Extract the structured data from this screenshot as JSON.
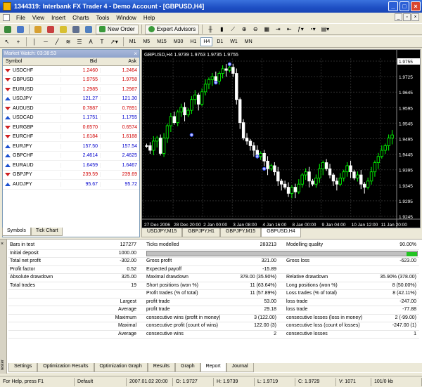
{
  "window": {
    "title": "1344319: Interbank FX Trader 4 - Demo Account - [GBPUSD,H4]"
  },
  "menu": [
    "File",
    "View",
    "Insert",
    "Charts",
    "Tools",
    "Window",
    "Help"
  ],
  "toolbar": {
    "new_order": "New Order",
    "expert_advisors": "Expert Advisors",
    "timeframes": [
      "M1",
      "M5",
      "M15",
      "M30",
      "H1",
      "H4",
      "D1",
      "W1",
      "MN"
    ],
    "active_timeframe": "H4",
    "text_tool": "A",
    "text_label_tool": "T"
  },
  "market_watch": {
    "title": "Market Watch: 03:38:53",
    "columns": [
      "Symbol",
      "Bid",
      "Ask"
    ],
    "rows": [
      {
        "symbol": "USDCHF",
        "bid": "1.2460",
        "ask": "1.2464",
        "dir": "down"
      },
      {
        "symbol": "GBPUSD",
        "bid": "1.9755",
        "ask": "1.9758",
        "dir": "down"
      },
      {
        "symbol": "EURUSD",
        "bid": "1.2985",
        "ask": "1.2987",
        "dir": "down"
      },
      {
        "symbol": "USDJPY",
        "bid": "121.27",
        "ask": "121.30",
        "dir": "up"
      },
      {
        "symbol": "AUDUSD",
        "bid": "0.7887",
        "ask": "0.7891",
        "dir": "down"
      },
      {
        "symbol": "USDCAD",
        "bid": "1.1751",
        "ask": "1.1755",
        "dir": "up"
      },
      {
        "symbol": "EURGBP",
        "bid": "0.6570",
        "ask": "0.6574",
        "dir": "down"
      },
      {
        "symbol": "EURCHF",
        "bid": "1.6184",
        "ask": "1.6188",
        "dir": "down"
      },
      {
        "symbol": "EURJPY",
        "bid": "157.50",
        "ask": "157.54",
        "dir": "up"
      },
      {
        "symbol": "GBPCHF",
        "bid": "2.4614",
        "ask": "2.4625",
        "dir": "up"
      },
      {
        "symbol": "EURAUD",
        "bid": "1.6459",
        "ask": "1.6467",
        "dir": "up"
      },
      {
        "symbol": "GBPJPY",
        "bid": "239.59",
        "ask": "239.69",
        "dir": "down"
      },
      {
        "symbol": "AUDJPY",
        "bid": "95.67",
        "ask": "95.72",
        "dir": "up"
      }
    ],
    "tabs": [
      "Symbols",
      "Tick Chart"
    ]
  },
  "chart": {
    "header": "GBPUSD,H4  1.9739 1.9763 1.9735 1.9755",
    "price_labels": [
      "1.9755",
      "1.9725",
      "1.9645",
      "1.9595",
      "1.9545",
      "1.9495",
      "1.9445",
      "1.9395",
      "1.9345",
      "1.9295",
      "1.9245"
    ],
    "date_labels": [
      "27 Dec 2006",
      "28 Dec 20:00",
      "2 Jan 00:00",
      "3 Jan 08:00",
      "4 Jan 16:00",
      "8 Jan 00:00",
      "9 Jan 04:00",
      "10 Jan 12:00",
      "11 Jan 20:00"
    ],
    "tabs": [
      "USDJPY,M15",
      "GBPJPY,H1",
      "GBPJPY,M15",
      "GBPUSD,H4"
    ],
    "active_tab": "GBPUSD,H4"
  },
  "report": {
    "row1": {
      "label": "Bars in test",
      "value": "127277",
      "label2": "Ticks modelled",
      "value2": "283213",
      "label3": "Modelling quality",
      "value3": "90.00%"
    },
    "row2": {
      "label": "Initial deposit",
      "value": "1000.00"
    },
    "row3": {
      "label": "Total net profit",
      "value": "-302.00",
      "label2": "Gross profit",
      "value2": "321.00",
      "label3": "Gross loss",
      "value3": "-623.00"
    },
    "row4": {
      "label": "Profit factor",
      "value": "0.52",
      "label2": "Expected payoff",
      "value2": "-15.89"
    },
    "row5": {
      "label": "Absolute drawdown",
      "value": "325.00",
      "label2": "Maximal drawdown",
      "value2": "378.00 (35.90%)",
      "label3": "Relative drawdown",
      "value3": "35.90% (378.00)"
    },
    "row6": {
      "label": "Total trades",
      "value": "19",
      "label2": "Short positions (won %)",
      "value2": "11 (63.64%)",
      "label3": "Long positions (won %)",
      "value3": "8 (50.00%)"
    },
    "row7": {
      "label2": "Profit trades (% of total)",
      "value2": "11 (57.89%)",
      "label3": "Loss trades (% of total)",
      "value3": "8 (42.11%)"
    },
    "row8": {
      "label": "Largest",
      "label2": "profit trade",
      "value2": "53.00",
      "label3": "loss trade",
      "value3": "-247.00"
    },
    "row9": {
      "label": "Average",
      "label2": "profit trade",
      "value2": "29.18",
      "label3": "loss trade",
      "value3": "-77.88"
    },
    "row10": {
      "label": "Maximum",
      "label2": "consecutive wins (profit in money)",
      "value2": "3 (122.00)",
      "label3": "consecutive losses (loss in money)",
      "value3": "2 (-99.00)"
    },
    "row11": {
      "label": "Maximal",
      "label2": "consecutive profit (count of wins)",
      "value2": "122.00 (3)",
      "label3": "consecutive loss (count of losses)",
      "value3": "-247.00 (1)"
    },
    "row12": {
      "label": "Average",
      "label2": "consecutive wins",
      "value2": "2",
      "label3": "consecutive losses",
      "value3": "1"
    },
    "modelling_quality_fraction": 0.9
  },
  "tester": {
    "side_label": "Tester",
    "close": "×",
    "tabs": [
      "Settings",
      "Optimization Results",
      "Optimization Graph",
      "Results",
      "Graph",
      "Report",
      "Journal"
    ],
    "active_tab": "Report"
  },
  "status": [
    "For Help, press F1",
    "Default",
    "2007.01.02 20:00",
    "O: 1.9727",
    "H: 1.9739",
    "L: 1.9719",
    "C: 1.9729",
    "V: 1071",
    "101/0 kb"
  ],
  "colors": {
    "bull": "#00ff00",
    "bear": "#ffffff",
    "chart_bg": "#000000",
    "bid_red": "#d00000",
    "ask_blue": "#0000cc"
  }
}
